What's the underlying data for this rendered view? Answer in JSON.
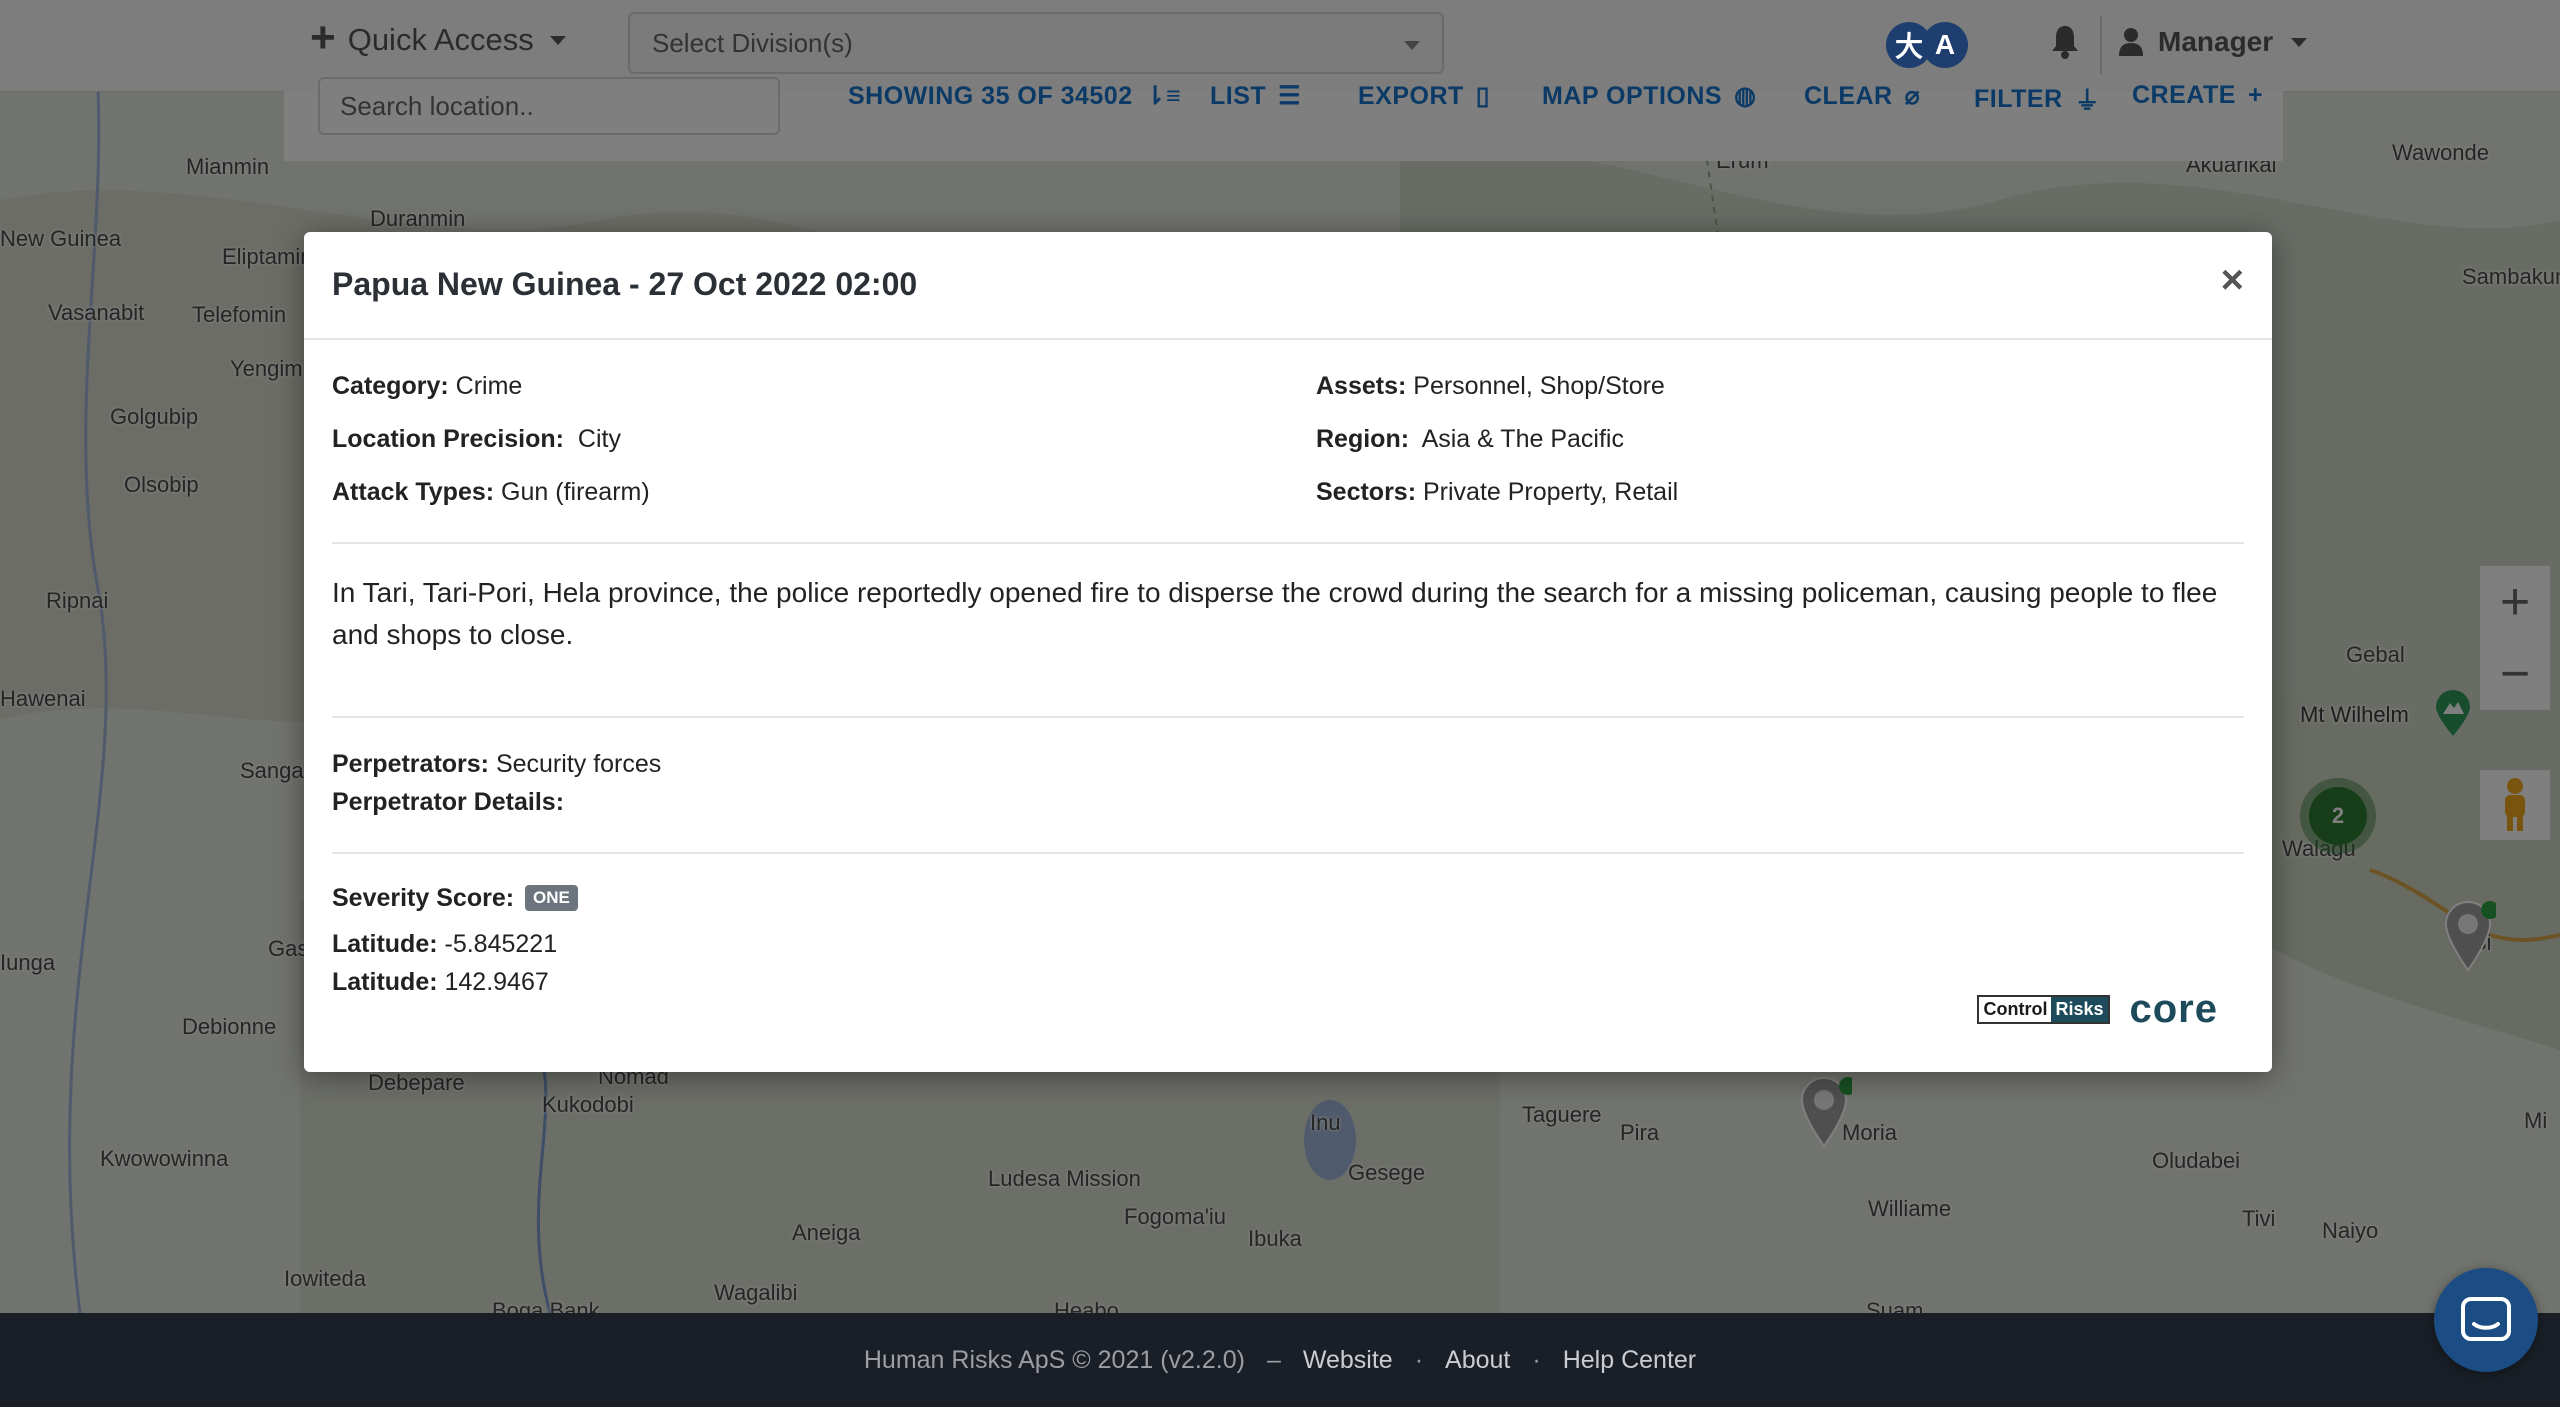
{
  "nav": {
    "quick_access": "Quick Access",
    "division_placeholder": "Select Division(s)",
    "language_glyphs": "大A",
    "user": "Manager"
  },
  "toolbar": {
    "search_placeholder": "Search location..",
    "showing": "SHOWING 35 OF 34502",
    "list": "LIST",
    "export": "EXPORT",
    "map_options": "MAP OPTIONS",
    "clear": "CLEAR",
    "filter": "FILTER",
    "create": "CREATE"
  },
  "map": {
    "places": [
      "Mianmin",
      "Duranmin",
      "New Guinea",
      "Eliptamin",
      "Vasanabit",
      "Telefomin",
      "Yengim",
      "Golgubip",
      "Olsobip",
      "Ripnai",
      "Hawenai",
      "Sanga",
      "Iunga",
      "Gas",
      "Debionne",
      "Debepare",
      "Nomad",
      "Kukodobi",
      "Kwowowinna",
      "Iowiteda",
      "Boga Bank",
      "Wagalibi",
      "Aneiga",
      "Ludesa Mission",
      "Fogoma'iu",
      "Ibuka",
      "Inu",
      "Gesege",
      "Taguere",
      "Pira",
      "Moria",
      "Williame",
      "Oludabei",
      "Tivi",
      "Naiyo",
      "Heabo",
      "Suam",
      "Akuarikai",
      "Wawonde",
      "Sambakum",
      "Gebal",
      "Mt Wilhelm",
      "Walagu",
      "Si",
      "Mi",
      "Erum"
    ],
    "cluster_count": "2",
    "zoom_in": "+",
    "zoom_out": "−"
  },
  "modal": {
    "title": "Papua New Guinea - 27 Oct 2022 02:00",
    "close": "×",
    "category_label": "Category:",
    "category": "Crime",
    "location_precision_label": "Location Precision:",
    "location_precision": "City",
    "attack_types_label": "Attack Types:",
    "attack_types": "Gun (firearm)",
    "assets_label": "Assets:",
    "assets": "Personnel, Shop/Store",
    "region_label": "Region:",
    "region": "Asia & The Pacific",
    "sectors_label": "Sectors:",
    "sectors": "Private Property, Retail",
    "description": "In Tari, Tari-Pori, Hela province, the police reportedly opened fire to disperse the crowd during the search for a missing policeman, causing people to flee and shops to close.",
    "perpetrators_label": "Perpetrators:",
    "perpetrators": "Security forces",
    "perpetrator_details_label": "Perpetrator Details:",
    "perpetrator_details": "",
    "severity_label": "Severity Score:",
    "severity": "ONE",
    "latitude_label": "Latitude:",
    "latitude": "-5.845221",
    "longitude_label": "Latitude:",
    "longitude": "142.9467",
    "brand_control": "Control",
    "brand_risks": "Risks",
    "brand_core": "core"
  },
  "footer": {
    "copyright": "Human Risks ApS © 2021 (v2.2.0)",
    "dash": "–",
    "website": "Website",
    "dot": "·",
    "about": "About",
    "help_center": "Help Center"
  }
}
